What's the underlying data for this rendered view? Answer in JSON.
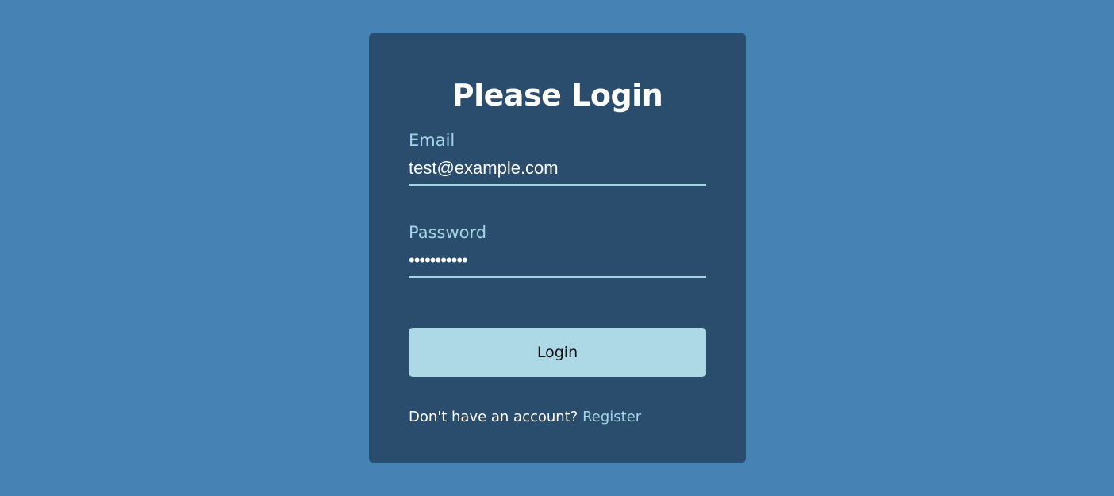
{
  "login_form": {
    "title": "Please Login",
    "email": {
      "label": "Email",
      "value": "test@example.com"
    },
    "password": {
      "label": "Password",
      "value": "•••••••••••"
    },
    "submit_label": "Login",
    "register_prompt": "Don't have an account?",
    "register_link": "Register"
  },
  "colors": {
    "background": "#4682b4",
    "card": "#2b4d6d",
    "accent": "#add8e6",
    "label": "#a3d4e6"
  }
}
